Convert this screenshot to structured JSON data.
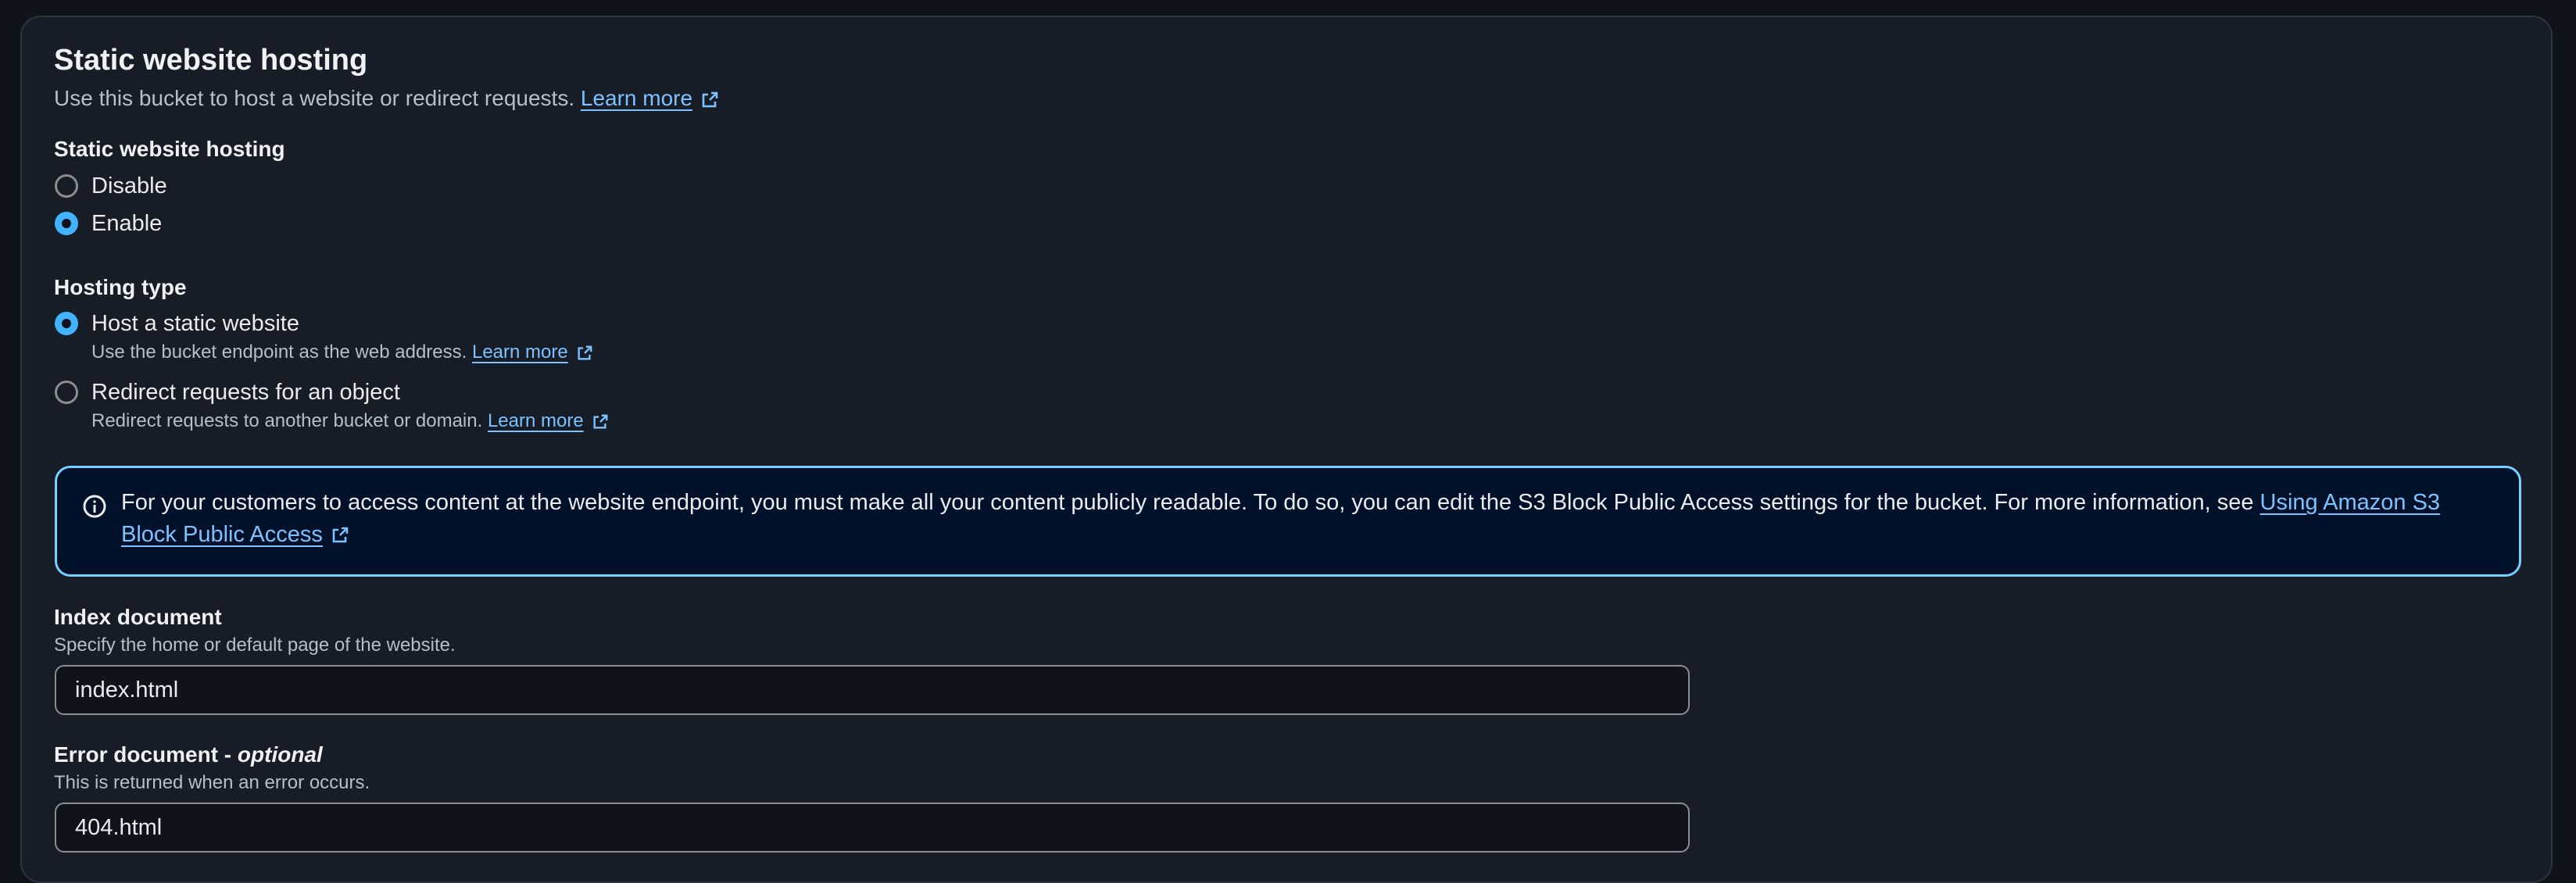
{
  "section": {
    "title": "Static website hosting",
    "description": "Use this bucket to host a website or redirect requests.",
    "learn_more": "Learn more"
  },
  "hosting_toggle": {
    "label": "Static website hosting",
    "options": [
      {
        "label": "Disable",
        "selected": false
      },
      {
        "label": "Enable",
        "selected": true
      }
    ]
  },
  "hosting_type": {
    "label": "Hosting type",
    "options": [
      {
        "label": "Host a static website",
        "description": "Use the bucket endpoint as the web address.",
        "learn_more": "Learn more",
        "selected": true
      },
      {
        "label": "Redirect requests for an object",
        "description": "Redirect requests to another bucket or domain.",
        "learn_more": "Learn more",
        "selected": false
      }
    ]
  },
  "info_alert": {
    "text": "For your customers to access content at the website endpoint, you must make all your content publicly readable. To do so, you can edit the S3 Block Public Access settings for the bucket. For more information, see ",
    "link": "Using Amazon S3 Block Public Access"
  },
  "index_document": {
    "label": "Index document",
    "description": "Specify the home or default page of the website.",
    "value": "index.html"
  },
  "error_document": {
    "label": "Error document - ",
    "label_optional": "optional",
    "description": "This is returned when an error occurs.",
    "value": "404.html"
  },
  "colors": {
    "background": "#161d26",
    "accent": "#42b4ff",
    "link": "#7ec1ff",
    "alert_border": "#75cfff",
    "alert_background": "#001129"
  }
}
